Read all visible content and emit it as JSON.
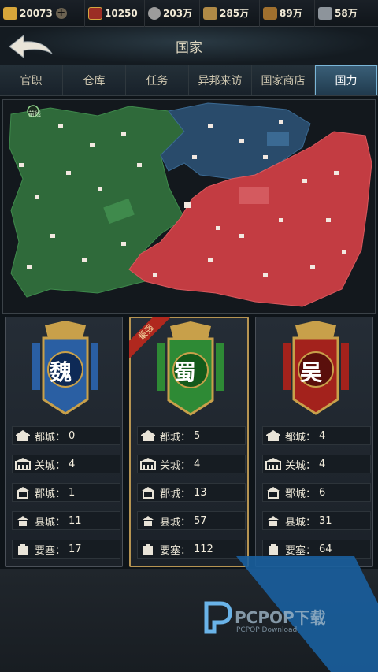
{
  "resources": [
    {
      "name": "gold-ingot-icon",
      "value": "20073",
      "color": "#d7a63a"
    },
    {
      "name": "tiger-token-icon",
      "value": "10250",
      "color": "#9b2d25"
    },
    {
      "name": "coin-icon",
      "value": "203万",
      "color": "#9c9c9c"
    },
    {
      "name": "grain-icon",
      "value": "285万",
      "color": "#b08a46"
    },
    {
      "name": "wood-icon",
      "value": "89万",
      "color": "#a0702e"
    },
    {
      "name": "iron-icon",
      "value": "58万",
      "color": "#8d949b"
    }
  ],
  "header": {
    "title": "国家"
  },
  "tabs": [
    {
      "label": "官职",
      "active": false
    },
    {
      "label": "仓库",
      "active": false
    },
    {
      "label": "任务",
      "active": false
    },
    {
      "label": "异邦来访",
      "active": false
    },
    {
      "label": "国家商店",
      "active": false
    },
    {
      "label": "国力",
      "active": true
    }
  ],
  "map": {
    "frontline_label": "前线",
    "colors": {
      "wei": "#2f6a3a",
      "shu": "#c33c42",
      "wu": "#294b6b"
    }
  },
  "factions": [
    {
      "name": "魏",
      "color": "#2a5fa3",
      "strongest": false,
      "stats": [
        {
          "label": "都城：",
          "value": "0"
        },
        {
          "label": "关城：",
          "value": "4"
        },
        {
          "label": "郡城：",
          "value": "1"
        },
        {
          "label": "县城：",
          "value": "11"
        },
        {
          "label": "要塞：",
          "value": "17"
        }
      ]
    },
    {
      "name": "蜀",
      "color": "#2e8a35",
      "strongest": true,
      "badge": "最强",
      "stats": [
        {
          "label": "都城：",
          "value": "5"
        },
        {
          "label": "关城：",
          "value": "4"
        },
        {
          "label": "郡城：",
          "value": "13"
        },
        {
          "label": "县城：",
          "value": "57"
        },
        {
          "label": "要塞：",
          "value": "112"
        }
      ]
    },
    {
      "name": "吴",
      "color": "#a3221c",
      "strongest": false,
      "stats": [
        {
          "label": "都城：",
          "value": "4"
        },
        {
          "label": "关城：",
          "value": "4"
        },
        {
          "label": "郡城：",
          "value": "6"
        },
        {
          "label": "县城：",
          "value": "31"
        },
        {
          "label": "要塞：",
          "value": "64"
        }
      ]
    }
  ],
  "watermark": {
    "text": "PCPOP下载",
    "sub": "PCPOP Download"
  }
}
